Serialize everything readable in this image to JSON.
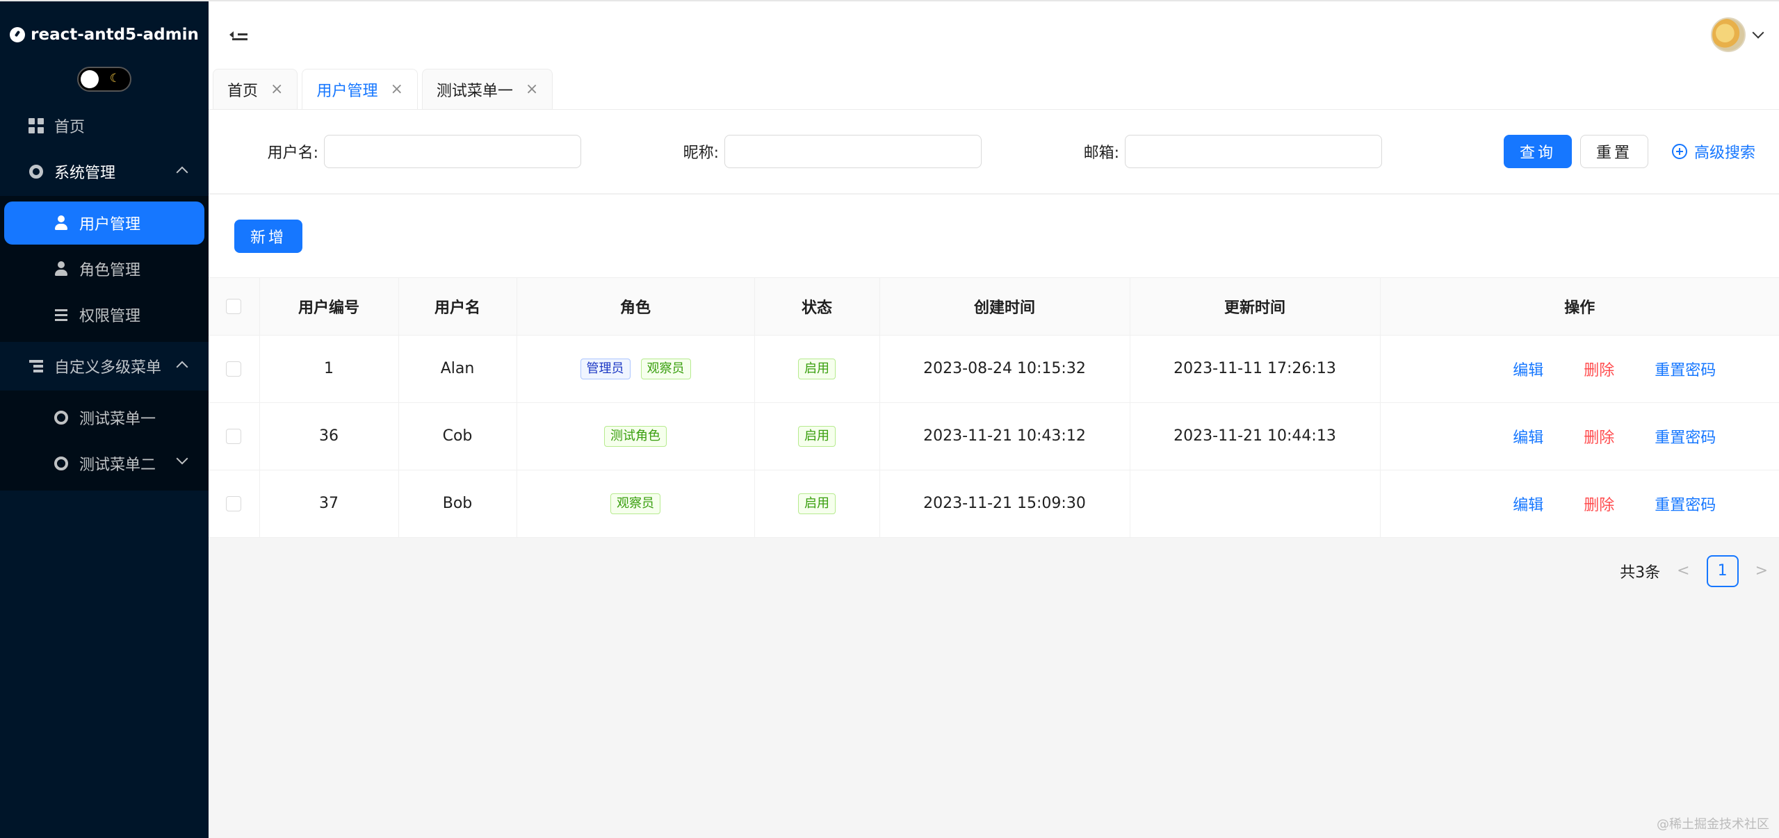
{
  "app": {
    "logo_text": "react-antd5-admin"
  },
  "sidebar": {
    "items": [
      {
        "label": "首页"
      },
      {
        "label": "系统管理"
      },
      {
        "label": "用户管理"
      },
      {
        "label": "角色管理"
      },
      {
        "label": "权限管理"
      },
      {
        "label": "自定义多级菜单"
      },
      {
        "label": "测试菜单一"
      },
      {
        "label": "测试菜单二"
      }
    ]
  },
  "tabs": [
    {
      "label": "首页",
      "close": "×"
    },
    {
      "label": "用户管理",
      "close": "×"
    },
    {
      "label": "测试菜单一",
      "close": "×"
    }
  ],
  "search": {
    "username_label": "用户名:",
    "nickname_label": "昵称:",
    "email_label": "邮箱:",
    "query_button": "查询",
    "reset_button": "重置",
    "advanced_label": "高级搜索"
  },
  "toolbar": {
    "add_button": "新增"
  },
  "table": {
    "headers": [
      "用户编号",
      "用户名",
      "角色",
      "状态",
      "创建时间",
      "更新时间",
      "操作"
    ],
    "rows": [
      {
        "id": "1",
        "username": "Alan",
        "roles": [
          "管理员",
          "观察员"
        ],
        "status": "启用",
        "created": "2023-08-24 10:15:32",
        "updated": "2023-11-11 17:26:13"
      },
      {
        "id": "36",
        "username": "Cob",
        "roles": [
          "测试角色"
        ],
        "status": "启用",
        "created": "2023-11-21 10:43:12",
        "updated": "2023-11-21 10:44:13"
      },
      {
        "id": "37",
        "username": "Bob",
        "roles": [
          "观察员"
        ],
        "status": "启用",
        "created": "2023-11-21 15:09:30",
        "updated": ""
      }
    ],
    "actions": {
      "edit": "编辑",
      "delete": "删除",
      "reset_password": "重置密码"
    }
  },
  "pagination": {
    "total_text": "共3条",
    "current_page": "1",
    "prev": "<",
    "next": ">"
  },
  "watermark": "@稀土掘金技术社区",
  "colors": {
    "primary": "#1677ff",
    "sidebar": "#001529",
    "danger": "#ff4d4f"
  }
}
